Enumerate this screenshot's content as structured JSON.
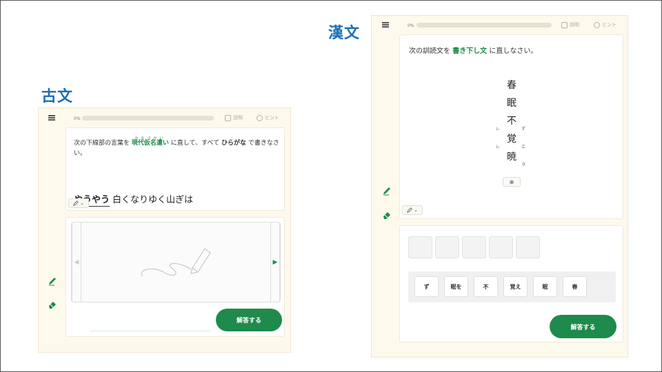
{
  "sections": {
    "kobun_title": "古文",
    "kanbun_title": "漢文"
  },
  "toolbar": {
    "progress_label": "0%",
    "progress_value": 0,
    "explain_label": "説明",
    "hint_label": "ヒント"
  },
  "kobun": {
    "instr_pre": "次の下線部の言葉を",
    "instr_em": "現代仮名遣い",
    "instr_ruby": "かなづかい",
    "instr_mid": "に直して、すべて",
    "instr_em2": "ひらがな",
    "instr_post": "で書きなさい。",
    "question_underlined": "やうやう",
    "question_rest": "白くなりゆく山ぎは",
    "pen_caret": "⌄",
    "nav_prev": "◀",
    "nav_next": "▶",
    "answer_button": "解答する"
  },
  "kanbun": {
    "instr_pre": "次の訓読文を",
    "instr_em": "書き下し文",
    "instr_post": "に直しなさい。",
    "chars": [
      {
        "c": "春",
        "kaeri": "",
        "okuri": ""
      },
      {
        "c": "眠",
        "kaeri": "",
        "okuri": ""
      },
      {
        "c": "不",
        "kaeri": "レ",
        "okuri": "ず"
      },
      {
        "c": "覚",
        "kaeri": "レ",
        "okuri": "エ"
      },
      {
        "c": "暁",
        "kaeri": "",
        "okuri": "ヲ"
      }
    ],
    "zoom_icon": "⊕",
    "pen_caret": "⌄",
    "choices": [
      "ず",
      "眠を",
      "不",
      "覚え",
      "眠",
      "春"
    ],
    "answer_button": "解答する"
  },
  "colors": {
    "accent_green": "#1e8a4c",
    "title_blue": "#1a6fb5",
    "panel_bg": "#fdf9ec"
  }
}
